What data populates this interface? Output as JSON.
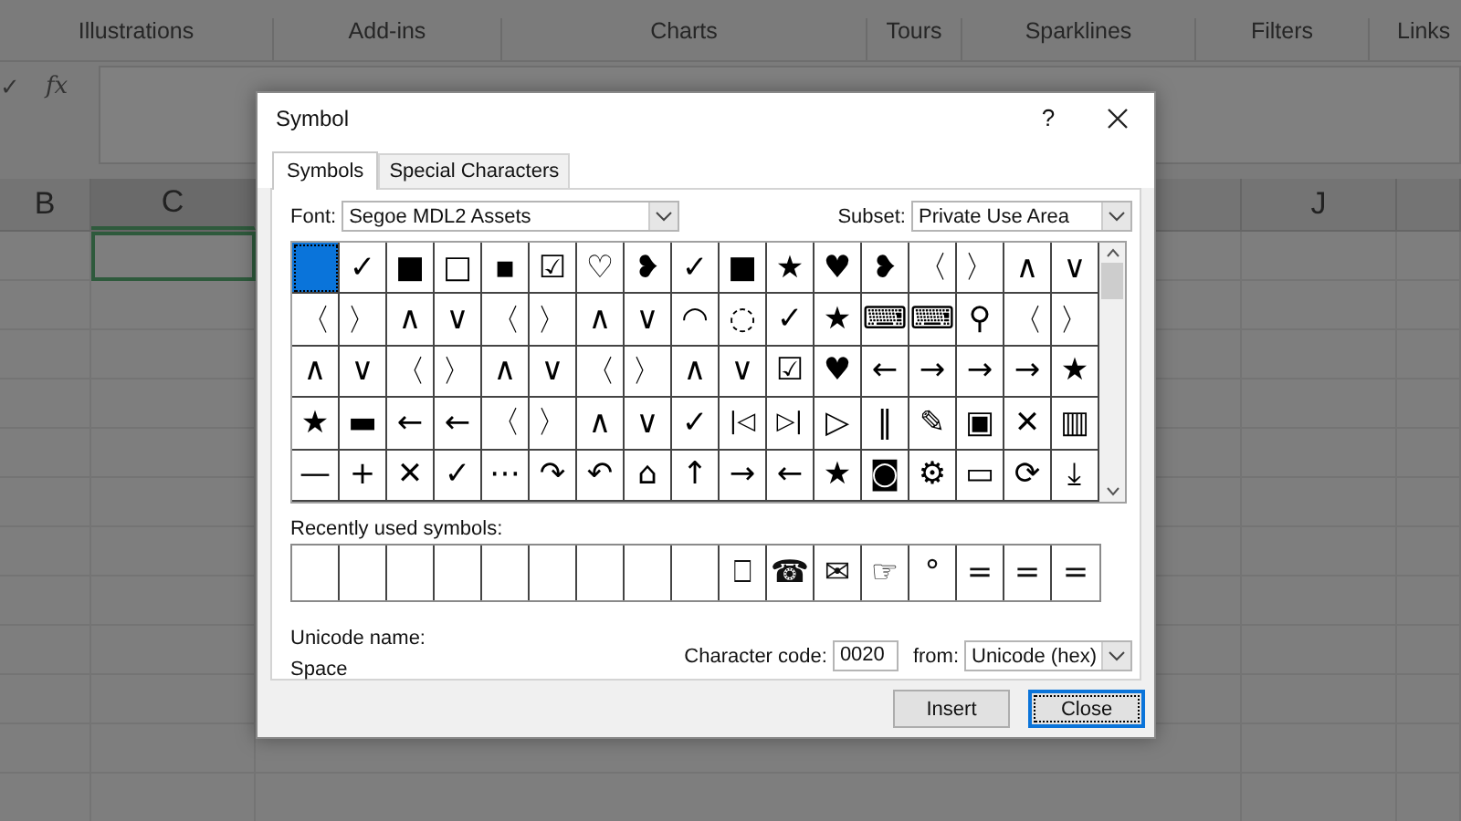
{
  "excel": {
    "ribbon_groups": [
      "Illustrations",
      "Add-ins",
      "Charts",
      "Tours",
      "Sparklines",
      "Filters",
      "Links"
    ],
    "formula_bar": {
      "enter": "✓",
      "function": "fx"
    },
    "columns": [
      {
        "label": "B",
        "selected": false
      },
      {
        "label": "C",
        "selected": true
      },
      {
        "label": "J",
        "selected": false
      }
    ]
  },
  "dialog": {
    "title": "Symbol",
    "help": "?",
    "tabs": [
      {
        "label": "Symbols",
        "selected": true
      },
      {
        "label": "Special Characters",
        "selected": false
      }
    ],
    "font": {
      "label": "Font:",
      "value": "Segoe MDL2 Assets"
    },
    "subset": {
      "label": "Subset:",
      "value": "Private Use Area"
    },
    "symbol_rows": [
      {
        "cells": [
          {
            "selected": true
          },
          {
            "glyph": "✓",
            "selected": false
          },
          {
            "glyph": "■",
            "selected": false
          },
          {
            "glyph": "□",
            "selected": false
          },
          {
            "glyph": "▪",
            "selected": false
          },
          {
            "glyph": "☑",
            "selected": false
          },
          {
            "glyph": "♡",
            "selected": false
          },
          {
            "glyph": "❥",
            "selected": false
          },
          {
            "glyph": "✓",
            "selected": false
          },
          {
            "glyph": "■",
            "selected": false
          },
          {
            "glyph": "★",
            "selected": false
          },
          {
            "glyph": "♥",
            "selected": false
          },
          {
            "glyph": "❥",
            "selected": false
          },
          {
            "glyph": "〈",
            "selected": false
          },
          {
            "glyph": "〉",
            "selected": false
          },
          {
            "glyph": "∧",
            "selected": false
          },
          {
            "glyph": "∨",
            "selected": false
          }
        ]
      },
      {
        "cells": [
          {
            "glyph": "〈",
            "selected": false
          },
          {
            "glyph": "〉",
            "selected": false
          },
          {
            "glyph": "∧",
            "selected": false
          },
          {
            "glyph": "∨",
            "selected": false
          },
          {
            "glyph": "〈",
            "selected": false
          },
          {
            "glyph": "〉",
            "selected": false
          },
          {
            "glyph": "∧",
            "selected": false
          },
          {
            "glyph": "∨",
            "selected": false
          },
          {
            "glyph": "◠",
            "selected": false
          },
          {
            "glyph": "◌",
            "selected": false
          },
          {
            "glyph": "✓",
            "selected": false
          },
          {
            "glyph": "★",
            "selected": false
          },
          {
            "glyph": "⌨",
            "selected": false
          },
          {
            "glyph": "⌨",
            "selected": false
          },
          {
            "glyph": "⚲",
            "selected": false
          },
          {
            "glyph": "〈",
            "selected": false
          },
          {
            "glyph": "〉",
            "selected": false
          }
        ]
      },
      {
        "cells": [
          {
            "glyph": "∧",
            "selected": false
          },
          {
            "glyph": "∨",
            "selected": false
          },
          {
            "glyph": "〈",
            "selected": false
          },
          {
            "glyph": "〉",
            "selected": false
          },
          {
            "glyph": "∧",
            "selected": false
          },
          {
            "glyph": "∨",
            "selected": false
          },
          {
            "glyph": "〈",
            "selected": false
          },
          {
            "glyph": "〉",
            "selected": false
          },
          {
            "glyph": "∧",
            "selected": false
          },
          {
            "glyph": "∨",
            "selected": false
          },
          {
            "glyph": "☑",
            "selected": false
          },
          {
            "glyph": "♥",
            "selected": false
          },
          {
            "glyph": "←",
            "selected": false
          },
          {
            "glyph": "→",
            "selected": false
          },
          {
            "glyph": "→",
            "selected": false
          },
          {
            "glyph": "→",
            "selected": false
          },
          {
            "glyph": "★",
            "selected": false
          }
        ]
      },
      {
        "cells": [
          {
            "glyph": "★",
            "selected": false
          },
          {
            "glyph": "▬",
            "selected": false
          },
          {
            "glyph": "←",
            "selected": false
          },
          {
            "glyph": "←",
            "selected": false
          },
          {
            "glyph": "〈",
            "selected": false
          },
          {
            "glyph": "〉",
            "selected": false
          },
          {
            "glyph": "∧",
            "selected": false
          },
          {
            "glyph": "∨",
            "selected": false
          },
          {
            "glyph": "✓",
            "selected": false
          },
          {
            "glyph": "|◁",
            "selected": false
          },
          {
            "glyph": "▷|",
            "selected": false
          },
          {
            "glyph": "▷",
            "selected": false
          },
          {
            "glyph": "‖",
            "selected": false
          },
          {
            "glyph": "✎",
            "selected": false
          },
          {
            "glyph": "▣",
            "selected": false
          },
          {
            "glyph": "✕",
            "selected": false
          },
          {
            "glyph": "▥",
            "selected": false
          }
        ]
      },
      {
        "cells": [
          {
            "glyph": "—",
            "selected": false
          },
          {
            "glyph": "+",
            "selected": false
          },
          {
            "glyph": "✕",
            "selected": false
          },
          {
            "glyph": "✓",
            "selected": false
          },
          {
            "glyph": "⋯",
            "selected": false
          },
          {
            "glyph": "↷",
            "selected": false
          },
          {
            "glyph": "↶",
            "selected": false
          },
          {
            "glyph": "⌂",
            "selected": false
          },
          {
            "glyph": "↑",
            "selected": false
          },
          {
            "glyph": "→",
            "selected": false
          },
          {
            "glyph": "←",
            "selected": false
          },
          {
            "glyph": "★",
            "selected": false
          },
          {
            "glyph": "◙",
            "selected": false
          },
          {
            "glyph": "⚙",
            "selected": false
          },
          {
            "glyph": "▭",
            "selected": false
          },
          {
            "glyph": "⟳",
            "selected": false
          },
          {
            "glyph": "⤓",
            "selected": false
          }
        ]
      }
    ],
    "recent_label": "Recently used symbols:",
    "recent_symbols": [
      "⎕",
      "☎",
      "✉",
      "☞",
      "°",
      "=",
      "=",
      "="
    ],
    "unicode_name_label": "Unicode name:",
    "unicode_name": "Space",
    "character_code": {
      "label": "Character code:",
      "value": "0020"
    },
    "from": {
      "label": "from:",
      "value": "Unicode (hex)"
    },
    "buttons": [
      {
        "label": "Insert",
        "default": false
      },
      {
        "label": "Close",
        "default": true
      }
    ]
  }
}
